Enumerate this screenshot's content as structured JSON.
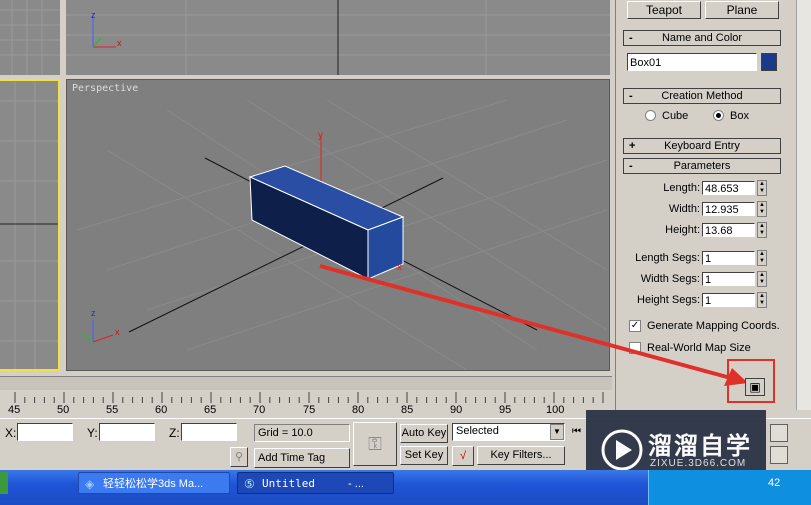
{
  "viewports": {
    "top_left_axis": {
      "y": "z",
      "x": "x"
    },
    "perspective": {
      "label": "Perspective",
      "object_axis": {
        "y": "y",
        "x": "x"
      },
      "corner_axis": {
        "y": "z",
        "x": "x"
      }
    }
  },
  "command_panel": {
    "buttons": [
      "Teapot",
      "Plane"
    ],
    "name_color": {
      "title": "Name and Color",
      "name_value": "Box01",
      "color": "#1c3a8a"
    },
    "creation_method": {
      "title": "Creation Method",
      "cube_label": "Cube",
      "box_label": "Box"
    },
    "keyboard_entry": {
      "title": "Keyboard Entry",
      "sign": "+"
    },
    "parameters": {
      "title": "Parameters",
      "sign": "-",
      "length_label": "Length:",
      "length": "48.653",
      "width_label": "Width:",
      "width": "12.935",
      "height_label": "Height:",
      "height": "13.68",
      "length_segs_label": "Length Segs:",
      "length_segs": "1",
      "width_segs_label": "Width Segs:",
      "width_segs": "1",
      "height_segs_label": "Height Segs:",
      "height_segs": "1",
      "gen_mapping": "Generate Mapping Coords.",
      "real_world": "Real-World Map Size"
    },
    "collapse_sign": "-"
  },
  "timeline": {
    "ticks": [
      "45",
      "50",
      "55",
      "60",
      "65",
      "70",
      "75",
      "80",
      "85",
      "90",
      "95",
      "100"
    ]
  },
  "status": {
    "x_label": "X:",
    "y_label": "Y:",
    "z_label": "Z:",
    "grid": "Grid = 10.0",
    "add_time_tag": "Add Time Tag",
    "auto_key": "Auto Key",
    "set_key": "Set Key",
    "selected": "Selected",
    "key_filters": "Key Filters..."
  },
  "taskbar": {
    "task1": "轻轻松松学3ds Ma...",
    "task2": "Untitled",
    "task2_suffix": "- ...",
    "clock": "42"
  },
  "watermark": {
    "brand": "溜溜自学",
    "url": "ZIXUE.3D66.COM"
  },
  "colors": {
    "viewport_bg": "#7f7f7f",
    "box": "#1c3a8a",
    "arrow": "#e0302a",
    "active_border": "#f0e040",
    "taskbar": "#1f55d6",
    "watermark_bg": "#2b3245"
  }
}
